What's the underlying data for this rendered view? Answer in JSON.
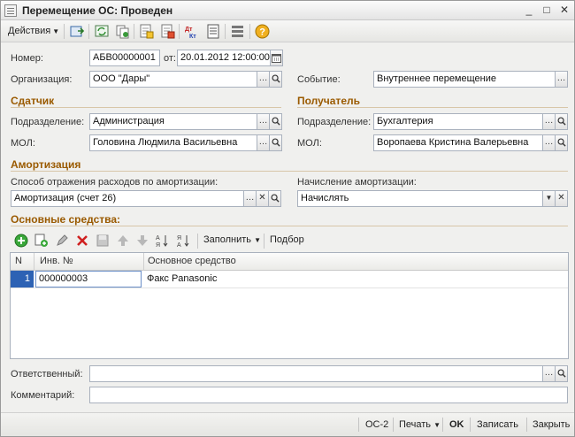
{
  "window": {
    "title": "Перемещение ОС: Проведен",
    "buttons": [
      "_",
      "□",
      "✕"
    ]
  },
  "toolbar": {
    "actions_label": "Действия"
  },
  "header": {
    "number_label": "Номер:",
    "number_value": "АБВ00000001",
    "from_label": "от:",
    "date_value": "20.01.2012 12:00:00",
    "org_label": "Организация:",
    "org_value": "ООО \"Дары\"",
    "event_label": "Событие:",
    "event_value": "Внутреннее перемещение"
  },
  "sender": {
    "title": "Сдатчик",
    "dept_label": "Подразделение:",
    "dept_value": "Администрация",
    "mol_label": "МОЛ:",
    "mol_value": "Головина Людмила Васильевна"
  },
  "receiver": {
    "title": "Получатель",
    "dept_label": "Подразделение:",
    "dept_value": "Бухгалтерия",
    "mol_label": "МОЛ:",
    "mol_value": "Воропаева Кристина Валерьевна"
  },
  "amortization": {
    "title": "Амортизация",
    "method_label": "Способ отражения расходов по амортизации:",
    "method_value": "Амортизация (счет 26)",
    "accrual_label": "Начисление амортизации:",
    "accrual_value": "Начислять"
  },
  "assets": {
    "title": "Основные средства:",
    "fill_label": "Заполнить",
    "select_label": "Подбор",
    "columns": [
      "N",
      "Инв. №",
      "Основное средство"
    ],
    "rows": [
      {
        "n": "1",
        "inv": "000000003",
        "asset": "Факс Panasonic"
      }
    ]
  },
  "footer": {
    "responsible_label": "Ответственный:",
    "responsible_value": "",
    "comment_label": "Комментарий:",
    "comment_value": ""
  },
  "bottom": {
    "os2": "ОС-2",
    "print": "Печать",
    "ok": "OK",
    "save": "Записать",
    "close": "Закрыть"
  }
}
